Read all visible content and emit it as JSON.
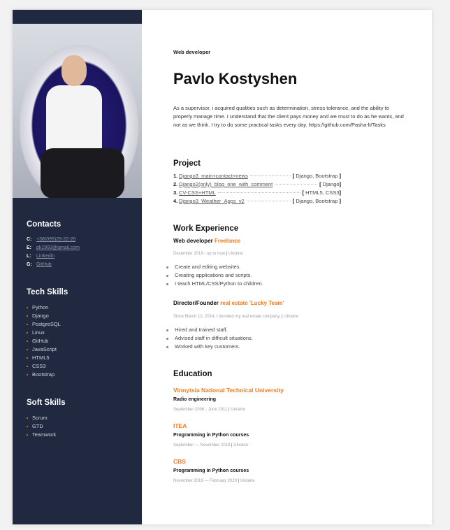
{
  "sidebar": {
    "contacts_title": "Contacts",
    "contacts": [
      {
        "key": "C:",
        "value": "+38(095)28-22-26"
      },
      {
        "key": "E:",
        "value": "pk1993@gmail.com"
      },
      {
        "key": "L:",
        "value": "Linkedin"
      },
      {
        "key": "G:",
        "value": "GitHub"
      }
    ],
    "tech_title": "Tech Skills",
    "tech": [
      "Python",
      "Django",
      "PostgreSQL",
      "Linux",
      "GitHub",
      "JavaScript",
      "HTML5",
      "CSS3",
      "Bootstrap"
    ],
    "soft_title": "Soft Skills",
    "soft": [
      "Scrum",
      "GTD",
      "Teamwork"
    ]
  },
  "main": {
    "role": "Web developer",
    "name": "Pavlo Kostyshen",
    "about": "As a supervisor, i acquired qualities such as determination, stress tolerance, and the ability to properly manage time. I understand that the client pays money and we must to do as he wants, and not as we think. I try to do some practical tasks every day. https://github.com/Pasha-lt/Tasks",
    "project_title": "Project",
    "projects": [
      {
        "num": "1.",
        "title": "Django3_main+contact+news",
        "tag": "Django, Bootstrap"
      },
      {
        "num": "2.",
        "title": "Django2(only)_blog_one_with_comment",
        "tag": "Django"
      },
      {
        "num": "3.",
        "title": "CV-CSS+HTML",
        "tag": "HTML5, CSS3"
      },
      {
        "num": "4.",
        "title": "Django3_Weather_Apps_v2",
        "tag": "Django, Bootstrap"
      }
    ],
    "work_title": "Work Experience",
    "jobs": [
      {
        "role": "Web developer",
        "company": "Freelance",
        "period": "December 2019 - up to now",
        "place": "Ukraine",
        "items": [
          "Create and editing websites.",
          "Creating applications and scripts.",
          "I teach HTML/CSS/Python to children."
        ]
      },
      {
        "role": "Director/Founder",
        "company": "real estate 'Lucky Team'",
        "period": "Since March 12, 2014, I founded my real estate company.",
        "place": "Ukraine",
        "items": [
          "Hired and trained staff.",
          "Advised staff in difficult situations.",
          "Worked with key customers."
        ]
      }
    ],
    "education_title": "Education",
    "education": [
      {
        "school": "Vinnytsia National Technical University",
        "subject": "Radio engineering",
        "period": "September 2006 - June 2011",
        "place": "Ukraine"
      },
      {
        "school": "ITEA",
        "subject": "Programming in Python courses",
        "period": "September — November 2019",
        "place": "Ukraine"
      },
      {
        "school": "CBS",
        "subject": "Programming in Python courses",
        "period": "November 2019 — February 2020",
        "place": "Ukraine"
      }
    ]
  }
}
